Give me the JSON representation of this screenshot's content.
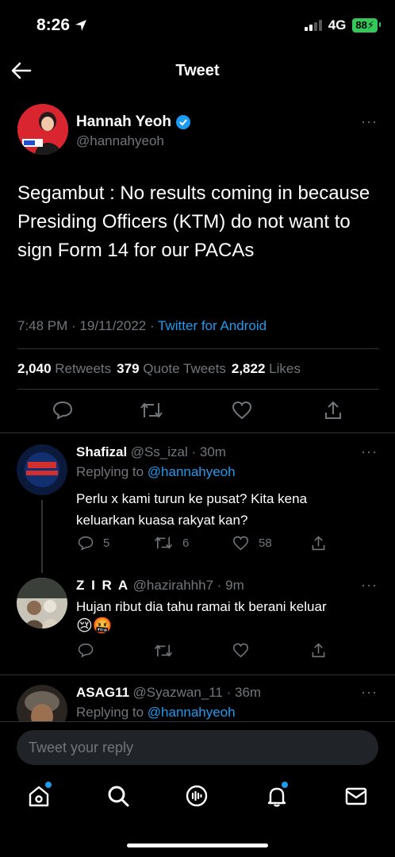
{
  "status": {
    "time": "8:26",
    "network": "4G",
    "battery": "88"
  },
  "header": {
    "title": "Tweet",
    "back_icon": "arrow-left-icon"
  },
  "tweet": {
    "name": "Hannah Yeoh",
    "handle": "@hannahyeoh",
    "text": "Segambut : No results coming in because Presiding Officers (KTM) do not want to sign Form 14 for our PACAs",
    "timestamp": "7:48 PM · 19/11/2022 · ",
    "source": "Twitter for Android",
    "retweets": "2,040",
    "retweets_label": "Retweets",
    "quotes": "379",
    "quotes_label": "Quote Tweets",
    "likes": "2,822",
    "likes_label": "Likes",
    "more": "···"
  },
  "replies": [
    {
      "name": "Shafizal",
      "handle": "@Ss_izal · 30m",
      "replying_prefix": "Replying to ",
      "replying_to": "@hannahyeoh",
      "text": "Perlu x kami turun ke pusat? Kita kena keluarkan kuasa rakyat kan?",
      "reply_count": "5",
      "retweet_count": "6",
      "like_count": "58",
      "more": "···"
    },
    {
      "name": "Z I R A",
      "handle": "@hazirahhh7 · 9m",
      "text": "Hujan ribut dia tahu ramai tk berani keluar",
      "emoji": "😢🤬",
      "more": "···"
    },
    {
      "name": "ASAG11",
      "handle": "@Syazwan_11 · 36m",
      "replying_prefix": "Replying to ",
      "replying_to": "@hannahyeoh",
      "more": "···"
    }
  ],
  "composer": {
    "placeholder": "Tweet your reply"
  },
  "colors": {
    "accent": "#1d9bf0",
    "background": "#000000",
    "muted": "#71767b"
  }
}
